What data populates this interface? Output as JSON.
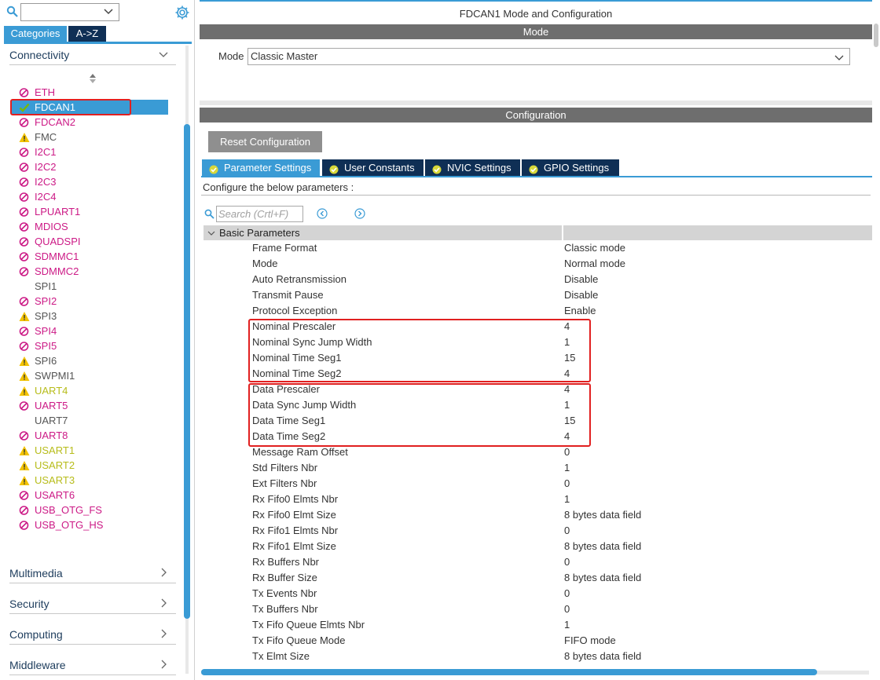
{
  "left": {
    "search_value": "",
    "tabs": [
      {
        "label": "Categories",
        "active": true
      },
      {
        "label": "A->Z",
        "active": false
      }
    ],
    "groups": [
      {
        "label": "Connectivity",
        "expanded": true
      },
      {
        "label": "Multimedia",
        "expanded": false
      },
      {
        "label": "Security",
        "expanded": false
      },
      {
        "label": "Computing",
        "expanded": false
      },
      {
        "label": "Middleware",
        "expanded": false
      }
    ],
    "peripherals": [
      {
        "label": "ETH",
        "status": "disabled"
      },
      {
        "label": "FDCAN1",
        "status": "ok",
        "selected": true
      },
      {
        "label": "FDCAN2",
        "status": "disabled"
      },
      {
        "label": "FMC",
        "status": "warning-neutral"
      },
      {
        "label": "I2C1",
        "status": "disabled"
      },
      {
        "label": "I2C2",
        "status": "disabled"
      },
      {
        "label": "I2C3",
        "status": "disabled"
      },
      {
        "label": "I2C4",
        "status": "disabled"
      },
      {
        "label": "LPUART1",
        "status": "disabled"
      },
      {
        "label": "MDIOS",
        "status": "disabled"
      },
      {
        "label": "QUADSPI",
        "status": "disabled"
      },
      {
        "label": "SDMMC1",
        "status": "disabled"
      },
      {
        "label": "SDMMC2",
        "status": "disabled"
      },
      {
        "label": "SPI1",
        "status": "none"
      },
      {
        "label": "SPI2",
        "status": "disabled"
      },
      {
        "label": "SPI3",
        "status": "warning-neutral"
      },
      {
        "label": "SPI4",
        "status": "disabled"
      },
      {
        "label": "SPI5",
        "status": "disabled"
      },
      {
        "label": "SPI6",
        "status": "warning-neutral"
      },
      {
        "label": "SWPMI1",
        "status": "warning-neutral"
      },
      {
        "label": "UART4",
        "status": "warning"
      },
      {
        "label": "UART5",
        "status": "disabled"
      },
      {
        "label": "UART7",
        "status": "none"
      },
      {
        "label": "UART8",
        "status": "disabled"
      },
      {
        "label": "USART1",
        "status": "warning"
      },
      {
        "label": "USART2",
        "status": "warning"
      },
      {
        "label": "USART3",
        "status": "warning"
      },
      {
        "label": "USART6",
        "status": "disabled"
      },
      {
        "label": "USB_OTG_FS",
        "status": "disabled"
      },
      {
        "label": "USB_OTG_HS",
        "status": "disabled"
      }
    ]
  },
  "right": {
    "window_title": "FDCAN1 Mode and Configuration",
    "mode_section_title": "Mode",
    "mode_label": "Mode",
    "mode_value": "Classic Master",
    "config_section_title": "Configuration",
    "reset_button": "Reset Configuration",
    "tabs": [
      {
        "label": "Parameter Settings",
        "active": true
      },
      {
        "label": "User Constants",
        "active": false
      },
      {
        "label": "NVIC Settings",
        "active": false
      },
      {
        "label": "GPIO Settings",
        "active": false
      }
    ],
    "hint": "Configure the below parameters :",
    "search_placeholder": "Search (Crtl+F)",
    "group_title": "Basic Parameters",
    "parameters": [
      {
        "name": "Frame Format",
        "value": "Classic mode"
      },
      {
        "name": "Mode",
        "value": "Normal mode"
      },
      {
        "name": "Auto Retransmission",
        "value": "Disable"
      },
      {
        "name": "Transmit Pause",
        "value": "Disable"
      },
      {
        "name": "Protocol Exception",
        "value": "Enable"
      },
      {
        "name": "Nominal Prescaler",
        "value": "4"
      },
      {
        "name": "Nominal Sync Jump Width",
        "value": "1"
      },
      {
        "name": "Nominal Time Seg1",
        "value": "15"
      },
      {
        "name": "Nominal Time Seg2",
        "value": "4"
      },
      {
        "name": "Data Prescaler",
        "value": "4"
      },
      {
        "name": "Data Sync Jump Width",
        "value": "1"
      },
      {
        "name": "Data Time Seg1",
        "value": "15"
      },
      {
        "name": "Data Time Seg2",
        "value": "4"
      },
      {
        "name": "Message Ram Offset",
        "value": "0"
      },
      {
        "name": "Std Filters Nbr",
        "value": "1"
      },
      {
        "name": "Ext Filters Nbr",
        "value": "0"
      },
      {
        "name": "Rx Fifo0 Elmts Nbr",
        "value": "1"
      },
      {
        "name": "Rx Fifo0 Elmt Size",
        "value": "8 bytes data field"
      },
      {
        "name": "Rx Fifo1 Elmts Nbr",
        "value": "0"
      },
      {
        "name": "Rx Fifo1 Elmt Size",
        "value": "8 bytes data field"
      },
      {
        "name": "Rx Buffers Nbr",
        "value": "0"
      },
      {
        "name": "Rx Buffer Size",
        "value": "8 bytes data field"
      },
      {
        "name": "Tx Events Nbr",
        "value": "0"
      },
      {
        "name": "Tx Buffers Nbr",
        "value": "0"
      },
      {
        "name": "Tx Fifo Queue Elmts Nbr",
        "value": "1"
      },
      {
        "name": "Tx Fifo Queue Mode",
        "value": "FIFO mode"
      },
      {
        "name": "Tx Elmt Size",
        "value": "8 bytes data field"
      }
    ]
  },
  "colors": {
    "accent": "#3a9bd5",
    "nav_dark": "#0f2f55",
    "disabled_magenta": "#cc1a86",
    "warning_yellow": "#b7bc1a",
    "ok_green": "#7ab800",
    "highlight_red": "#e12020"
  }
}
